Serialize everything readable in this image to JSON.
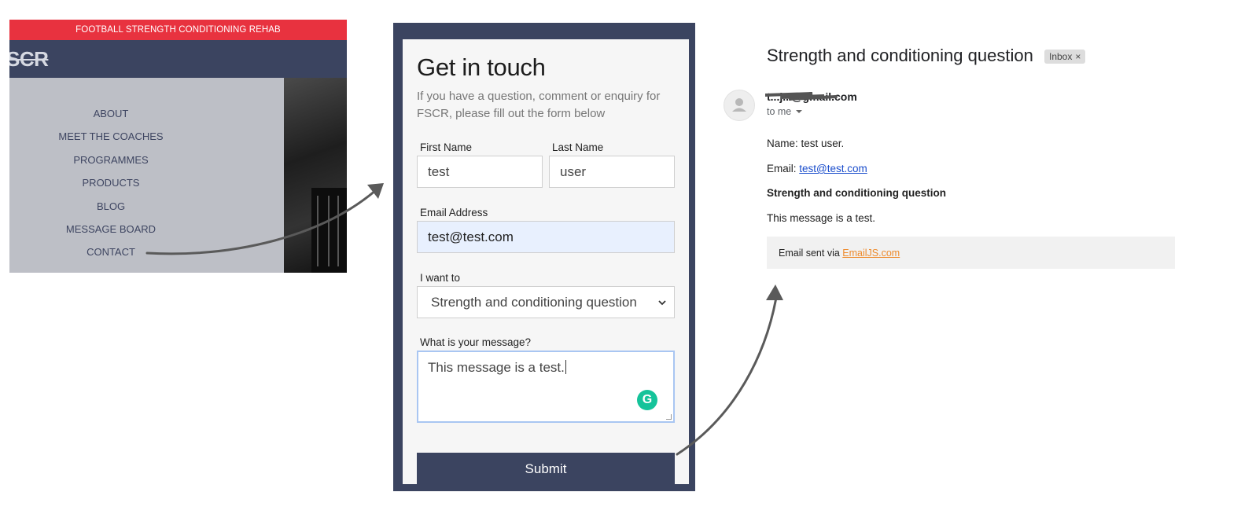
{
  "site": {
    "banner": "FOOTBALL STRENGTH CONDITIONING REHAB",
    "logo": "SCR",
    "menu": [
      "ABOUT",
      "MEET THE COACHES",
      "PROGRAMMES",
      "PRODUCTS",
      "BLOG",
      "MESSAGE BOARD",
      "CONTACT"
    ]
  },
  "form": {
    "title": "Get in touch",
    "intro": "If you have a question, comment or enquiry for FSCR, please fill out the form below",
    "first_name": {
      "label": "First Name",
      "value": "test"
    },
    "last_name": {
      "label": "Last Name",
      "value": "user"
    },
    "email": {
      "label": "Email Address",
      "value": "test@test.com"
    },
    "intent": {
      "label": "I want to",
      "selected": "Strength and conditioning question"
    },
    "message": {
      "label": "What is your message?",
      "value": "This message is a test."
    },
    "submit_label": "Submit"
  },
  "email": {
    "subject": "Strength and conditioning question",
    "tag": "Inbox",
    "sender": "t...j...@gmail.com",
    "recipient": "to me",
    "body": {
      "name_line": "Name: test user.",
      "email_label": "Email: ",
      "email_link": "test@test.com",
      "subject_line": "Strength and conditioning question",
      "message_line": "This message is a test."
    },
    "footer_text": "Email sent via ",
    "footer_link": "EmailJS.com"
  }
}
